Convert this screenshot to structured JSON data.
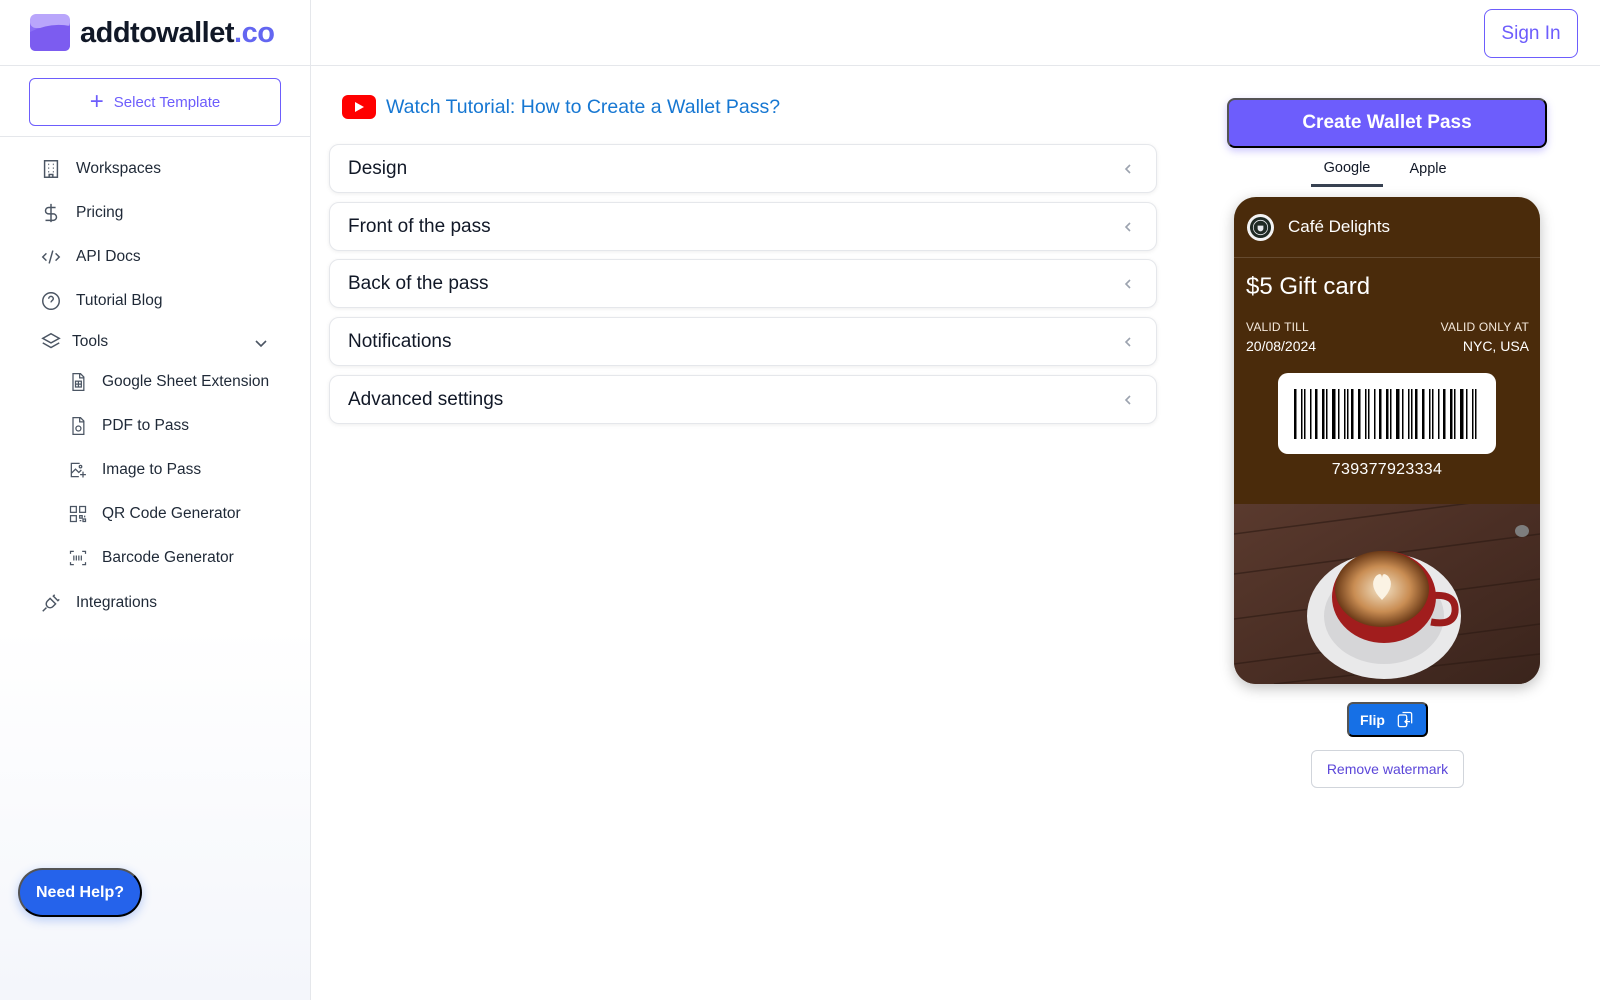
{
  "header": {
    "logo_text": "addtowallet",
    "logo_tld": ".co",
    "sign_in": "Sign In"
  },
  "sidebar": {
    "select_template": "Select Template",
    "items": [
      {
        "label": "Workspaces",
        "icon": "building-icon"
      },
      {
        "label": "Pricing",
        "icon": "dollar-icon"
      },
      {
        "label": "API Docs",
        "icon": "code-icon"
      },
      {
        "label": "Tutorial Blog",
        "icon": "help-circle-icon"
      },
      {
        "label": "Tools",
        "icon": "layers-icon"
      },
      {
        "label": "Integrations",
        "icon": "plug-icon"
      }
    ],
    "tools": [
      {
        "label": "Google Sheet Extension",
        "icon": "sheet-icon"
      },
      {
        "label": "PDF to Pass",
        "icon": "pdf-icon"
      },
      {
        "label": "Image to Pass",
        "icon": "image-icon"
      },
      {
        "label": "QR Code Generator",
        "icon": "qr-icon"
      },
      {
        "label": "Barcode Generator",
        "icon": "barcode-scan-icon"
      }
    ],
    "need_help": "Need Help?"
  },
  "main": {
    "tutorial_link": "Watch Tutorial: How to Create a Wallet Pass?",
    "sections": [
      "Design",
      "Front of the pass",
      "Back of the pass",
      "Notifications",
      "Advanced settings"
    ]
  },
  "preview": {
    "create_button": "Create Wallet Pass",
    "tabs": [
      "Google",
      "Apple"
    ],
    "active_tab": "Google",
    "pass": {
      "business_name": "Café Delights",
      "title": "$5 Gift card",
      "valid_till_label": "VALID TILL",
      "valid_till_value": "20/08/2024",
      "valid_at_label": "VALID ONLY AT",
      "valid_at_value": "NYC, USA",
      "barcode_number": "739377923334",
      "background_color": "#4a2b0b"
    },
    "flip": "Flip",
    "remove_watermark": "Remove watermark"
  },
  "colors": {
    "accent": "#6d5dfc",
    "link": "#1677d2",
    "help_button": "#2563eb"
  }
}
